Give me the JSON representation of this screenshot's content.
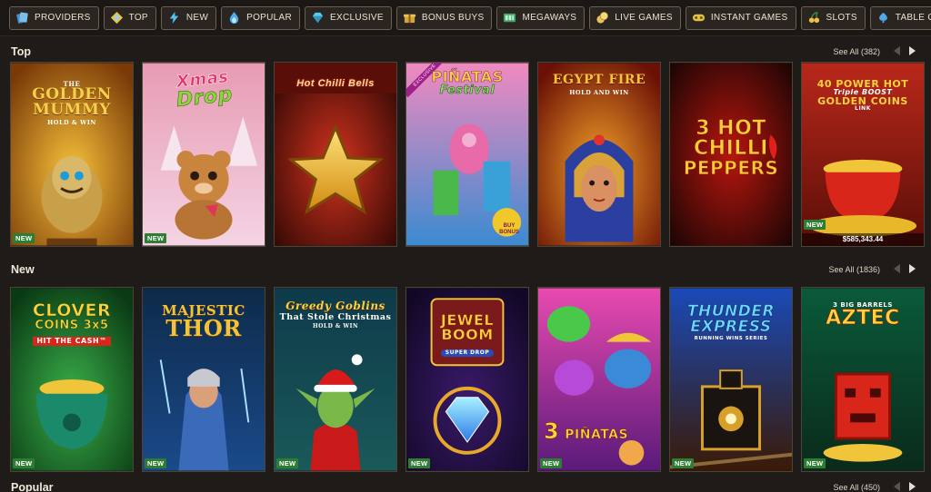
{
  "nav": [
    {
      "label": "PROVIDERS",
      "icon": "providers-icon"
    },
    {
      "label": "TOP",
      "icon": "top-icon"
    },
    {
      "label": "NEW",
      "icon": "new-icon"
    },
    {
      "label": "POPULAR",
      "icon": "popular-icon"
    },
    {
      "label": "EXCLUSIVE",
      "icon": "exclusive-icon"
    },
    {
      "label": "BONUS BUYS",
      "icon": "bonus-buys-icon"
    },
    {
      "label": "MEGAWAYS",
      "icon": "megaways-icon"
    },
    {
      "label": "LIVE GAMES",
      "icon": "live-games-icon"
    },
    {
      "label": "INSTANT GAMES",
      "icon": "instant-games-icon"
    },
    {
      "label": "SLOTS",
      "icon": "slots-icon"
    },
    {
      "label": "TABLE GAMES",
      "icon": "table-games-icon"
    }
  ],
  "sections": {
    "top": {
      "title": "Top",
      "see_all": "See All (382)",
      "games": [
        {
          "title_lines": [
            "THE",
            "GOLDEN",
            "MUMMY",
            "HOLD & WIN"
          ],
          "badge": "NEW"
        },
        {
          "title_lines": [
            "Xmas",
            "Drop"
          ],
          "badge": "NEW"
        },
        {
          "title_lines": [
            "Hot Chilli Bells"
          ],
          "badge": ""
        },
        {
          "title_lines": [
            "PIÑATAS",
            "Festival",
            "BUY BONUS"
          ],
          "ribbon": "EXCLUSIVE",
          "badge": ""
        },
        {
          "title_lines": [
            "EGYPT FIRE",
            "HOLD AND WIN"
          ],
          "badge": ""
        },
        {
          "title_lines": [
            "3 HOT",
            "CHILLI",
            "PEPPERS"
          ],
          "badge": ""
        },
        {
          "title_lines": [
            "40 POWER HOT",
            "Triple BOOST",
            "GOLDEN COINS",
            "LINK"
          ],
          "badge": "NEW",
          "jackpot": "$585,343.44"
        }
      ]
    },
    "new": {
      "title": "New",
      "see_all": "See All (1836)",
      "games": [
        {
          "title_lines": [
            "CLOVER",
            "COINS 3x5",
            "HIT THE CASH™"
          ],
          "badge": "NEW"
        },
        {
          "title_lines": [
            "MAJESTIC",
            "THOR"
          ],
          "badge": "NEW"
        },
        {
          "title_lines": [
            "Greedy Goblins",
            "That Stole Christmas",
            "HOLD & WIN"
          ],
          "badge": "NEW"
        },
        {
          "title_lines": [
            "JEWEL",
            "BOOM",
            "SUPER DROP"
          ],
          "badge": "NEW"
        },
        {
          "title_lines": [
            "3",
            "PIÑATAS"
          ],
          "badge": "NEW"
        },
        {
          "title_lines": [
            "THUNDER",
            "EXPRESS",
            "RUNNING WINS SERIES"
          ],
          "badge": "NEW"
        },
        {
          "title_lines": [
            "3 BIG BARRELS",
            "AZTEC"
          ],
          "badge": "NEW"
        }
      ]
    },
    "popular": {
      "title": "Popular",
      "see_all": "See All (450)"
    }
  }
}
